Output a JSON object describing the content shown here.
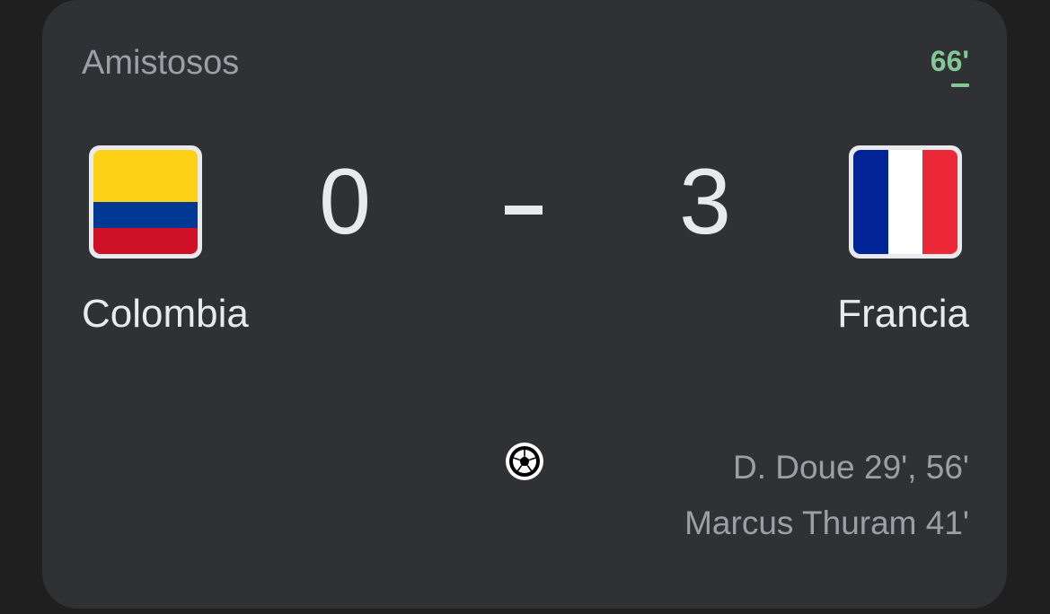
{
  "match": {
    "competition": "Amistosos",
    "live_minute": "66'",
    "home": {
      "name": "Colombia",
      "score": "0",
      "flag_colors": [
        "#fcd116",
        "#003893",
        "#ce1126"
      ]
    },
    "away": {
      "name": "Francia",
      "score": "3",
      "flag_colors": [
        "#002395",
        "#ffffff",
        "#ed2939"
      ]
    },
    "score_separator": "-",
    "goal_icon": "soccer-ball-icon",
    "away_scorers": [
      "D. Doue 29', 56'",
      "Marcus Thuram 41'"
    ]
  },
  "colors": {
    "background": "#1f1f1f",
    "card": "#303134",
    "live_accent": "#81c995",
    "primary_text": "#e8eaed",
    "secondary_text": "#9aa0a6"
  }
}
